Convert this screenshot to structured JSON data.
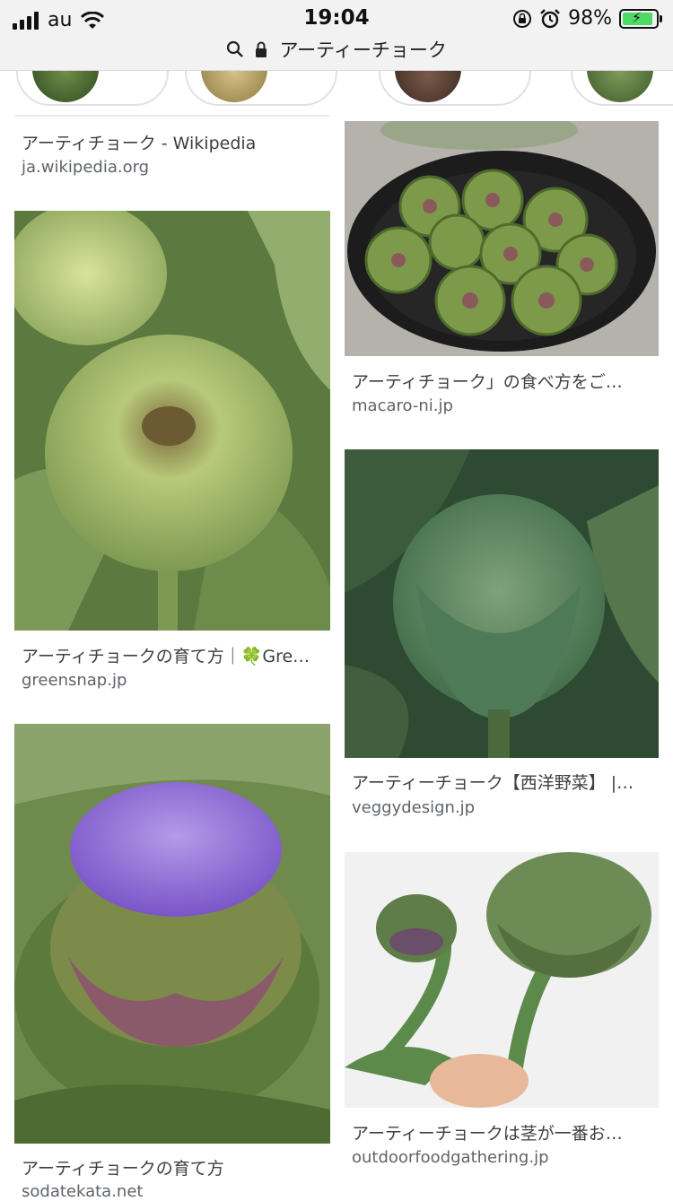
{
  "status_bar": {
    "carrier": "au",
    "time": "19:04",
    "battery": "98%",
    "battery_level": 0.98
  },
  "address_bar": {
    "query": "アーティーチョーク"
  },
  "results": {
    "left": [
      {
        "title": "アーティチョーク - Wikipedia",
        "source": "ja.wikipedia.org"
      },
      {
        "title": "アーティチョークの育て方｜🍀Gre…",
        "source": "greensnap.jp"
      },
      {
        "title": "アーティチョークの育て方",
        "source": "sodatekata.net"
      }
    ],
    "right": [
      {
        "title": "アーティチョーク」の食べ方をご…",
        "source": "macaro-ni.jp"
      },
      {
        "title": "アーティーチョーク【西洋野菜】 |…",
        "source": "veggydesign.jp"
      },
      {
        "title": "アーティーチョークは茎が一番お…",
        "source": "outdoorfoodgathering.jp"
      }
    ]
  }
}
